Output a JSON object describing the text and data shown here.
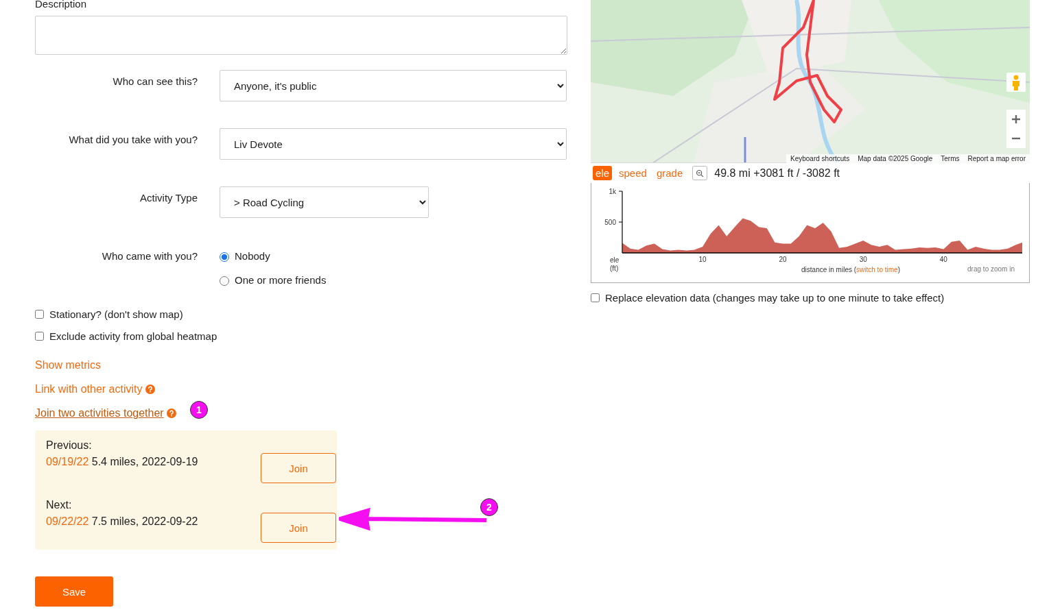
{
  "description": {
    "label": "Description"
  },
  "form_rows": [
    {
      "kind": "select",
      "label": "Who can see this?",
      "value": "Anyone, it's public",
      "wide": true
    },
    {
      "kind": "select",
      "label": "What did you take with you?",
      "value": "Liv Devote",
      "wide": true
    },
    {
      "kind": "select",
      "label": "Activity Type",
      "value": "> Road Cycling",
      "wide": false
    },
    {
      "kind": "radio",
      "label": "Who came with you?",
      "options": [
        {
          "label": "Nobody",
          "selected": true
        },
        {
          "label": "One or more friends",
          "selected": false
        }
      ]
    }
  ],
  "checkboxes": [
    {
      "label": "Stationary? (don't show map)",
      "checked": false
    },
    {
      "label": "Exclude activity from global heatmap",
      "checked": false
    }
  ],
  "links": [
    {
      "label": "Show metrics",
      "help": false,
      "underlined": false
    },
    {
      "label": "Link with other activity",
      "help": true,
      "underlined": false
    },
    {
      "label": "Join two activities together ",
      "help": true,
      "underlined": true
    }
  ],
  "join_panel": [
    {
      "heading": "Previous:",
      "date_link": "09/19/22",
      "detail": " 5.4 miles, 2022-09-19",
      "button": "Join"
    },
    {
      "heading": "Next:",
      "date_link": "09/22/22",
      "detail": " 7.5 miles, 2022-09-22",
      "button": "Join"
    }
  ],
  "save_button": "Save",
  "annotations": [
    "1",
    "2"
  ],
  "map": {
    "kind": "picture",
    "attribution": [
      "Keyboard shortcuts",
      "Map data ©2025 Google",
      "Terms",
      "Report a map error"
    ]
  },
  "profile_tabs": [
    {
      "label": "ele",
      "selected": true
    },
    {
      "label": "speed",
      "selected": false
    },
    {
      "label": "grade",
      "selected": false
    }
  ],
  "profile_summary": "49.8 mi +3081 ft / -3082 ft",
  "chart": {
    "xlabel_open": "(",
    "xlabel_link": "switch to time",
    "xlabel_close": ")",
    "hint": "drag to zoom in",
    "chart_data": {
      "type": "area",
      "xlabel": "distance in miles",
      "ylabel": "ele (ft)",
      "x": [
        0,
        1,
        2,
        3,
        4,
        5,
        6,
        7,
        8,
        9,
        10,
        11,
        12,
        13,
        14,
        15,
        16,
        17,
        18,
        19,
        20,
        21,
        22,
        23,
        24,
        25,
        26,
        27,
        28,
        29,
        30,
        31,
        32,
        33,
        34,
        35,
        36,
        37,
        38,
        39,
        40,
        41,
        42,
        43,
        44,
        45,
        46,
        47,
        48,
        49,
        49.8
      ],
      "series": [
        {
          "color": "#cd6158",
          "values": [
            160,
            70,
            50,
            120,
            150,
            60,
            40,
            50,
            40,
            50,
            100,
            310,
            450,
            270,
            420,
            560,
            520,
            420,
            400,
            170,
            150,
            150,
            270,
            450,
            400,
            490,
            350,
            80,
            100,
            150,
            200,
            130,
            100,
            130,
            50,
            60,
            70,
            90,
            80,
            90,
            60,
            180,
            200,
            50,
            100,
            70,
            50,
            50,
            70,
            130,
            170
          ]
        }
      ],
      "xlim": [
        0,
        49.8
      ],
      "ylim": [
        0,
        1000
      ],
      "xticks": [
        10,
        20,
        30,
        40
      ],
      "yticks": [
        500,
        {
          "value": 1000,
          "label": "1k"
        }
      ]
    }
  },
  "replace_elevation": {
    "label": "Replace elevation data (changes may take up to one minute to take effect)",
    "checked": false
  }
}
